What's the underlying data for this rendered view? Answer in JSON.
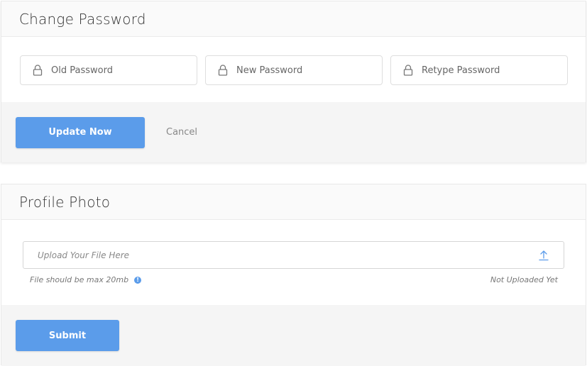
{
  "change_password": {
    "title": "Change Password",
    "fields": [
      {
        "placeholder": "Old Password",
        "icon": "lock-icon"
      },
      {
        "placeholder": "New Password",
        "icon": "lock-icon"
      },
      {
        "placeholder": "Retype Password",
        "icon": "lock-icon"
      }
    ],
    "update_label": "Update Now",
    "cancel_label": "Cancel"
  },
  "profile_photo": {
    "title": "Profile Photo",
    "upload_placeholder": "Upload Your File Here",
    "upload_icon": "upload-icon",
    "size_hint": "File should be max 20mb",
    "info_icon_glyph": "!",
    "status": "Not Uploaded Yet",
    "submit_label": "Submit"
  },
  "colors": {
    "accent": "#5b9cea",
    "footer_bg": "#f5f5f5",
    "header_bg": "#fafafa"
  }
}
